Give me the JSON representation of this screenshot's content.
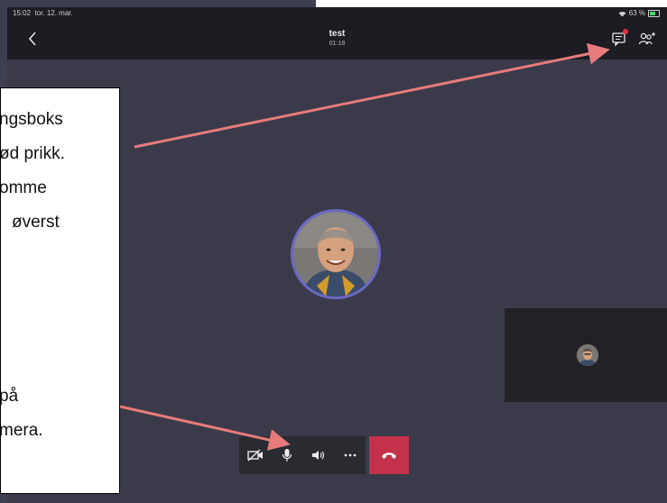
{
  "status_bar": {
    "time": "15:02",
    "date": "tor. 12. mar.",
    "battery": "63 %"
  },
  "call_header": {
    "title": "test",
    "timer": "01:18"
  },
  "callout": {
    "lines": [
      "ngsboks",
      "ød prikk.",
      "omme",
      "øverst",
      "på",
      "mera."
    ]
  },
  "controls": {
    "camera": "camera-off-icon",
    "mic": "microphone-icon",
    "speaker": "speaker-icon",
    "more": "more-icon",
    "hangup": "hang-up-icon"
  },
  "colors": {
    "accent": "#6b67c7",
    "hangup": "#c4314b",
    "annotation": "#e77b7b",
    "background": "#3b3a4a"
  }
}
